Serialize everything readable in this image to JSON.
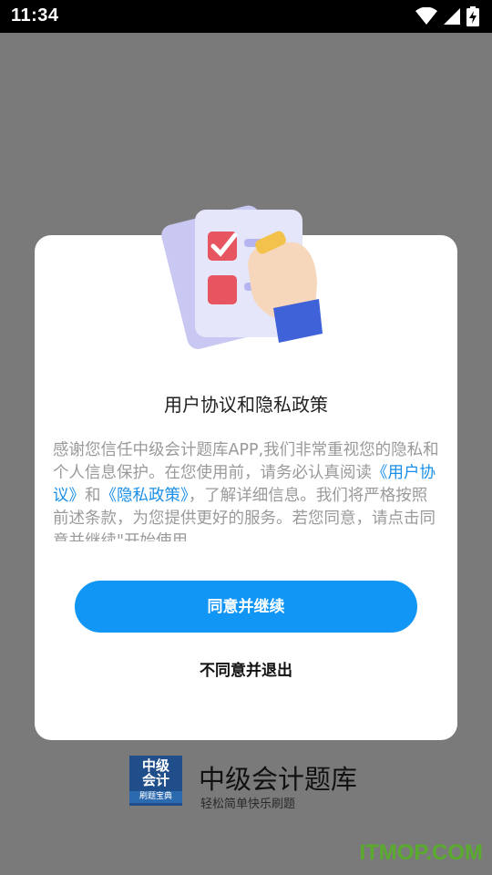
{
  "status_bar": {
    "time": "11:34"
  },
  "dialog": {
    "title": "用户协议和隐私政策",
    "body_part1": "感谢您信任中级会计题库APP,我们非常重视您的隐私和个人信息保护。在您使用前，请务必认真阅读",
    "link_user_agreement": "《用户协议》",
    "body_and": "和",
    "link_privacy_policy": "《隐私政策》",
    "body_part2": "，了解详细信息。我们将严格按照前述条款，为您提供更好的服务。若您同意，请点击同意并继续\"开始使用",
    "agree_label": "同意并继续",
    "decline_label": "不同意并退出"
  },
  "app": {
    "logo_line1": "中级",
    "logo_line2": "会计",
    "logo_sub": "刷题宝典",
    "name": "中级会计题库",
    "slogan": "轻松简单快乐刷题"
  },
  "watermark": "ITMOP.COM",
  "colors": {
    "accent": "#1296f6",
    "link": "#1a8fe8",
    "overlay": "#7a7a7a"
  }
}
